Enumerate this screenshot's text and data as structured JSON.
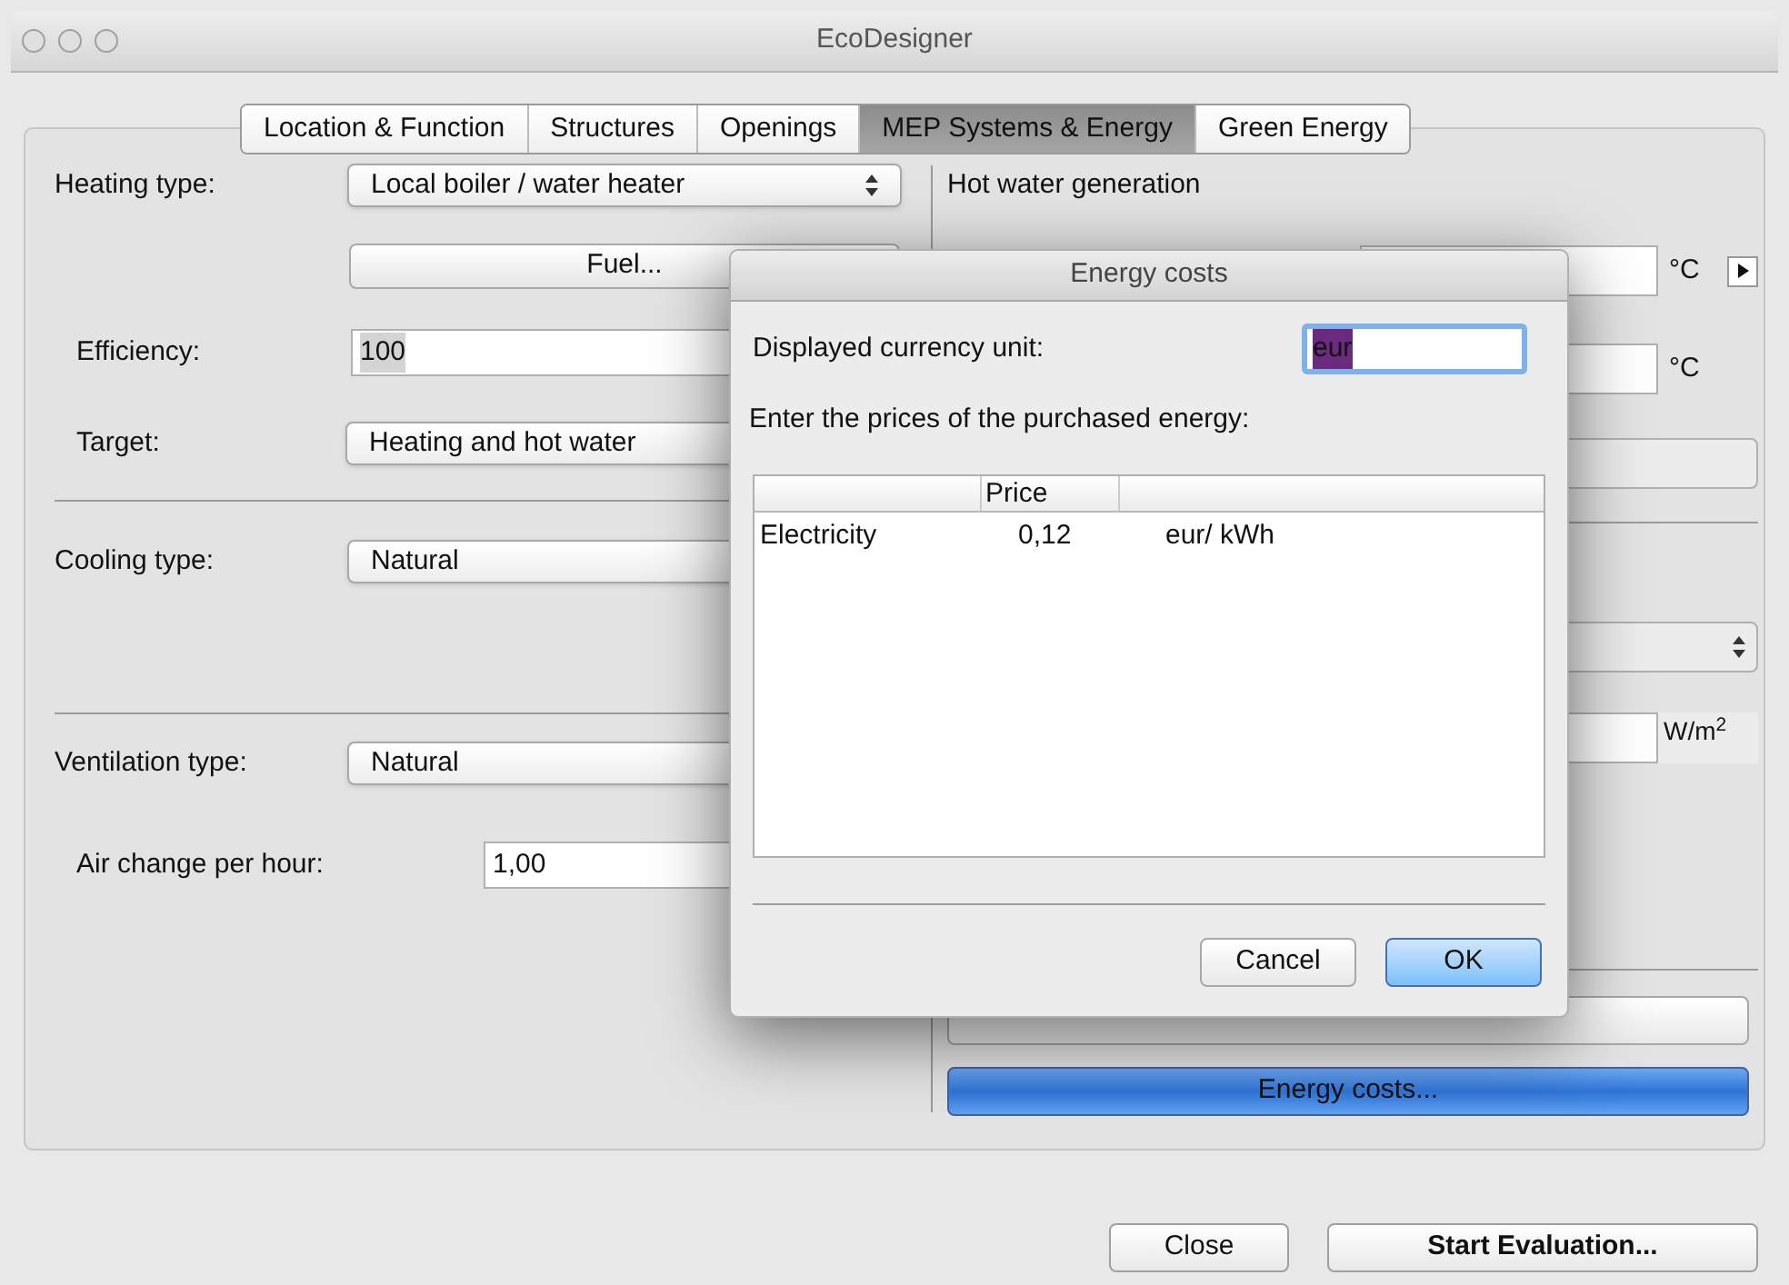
{
  "window": {
    "title": "EcoDesigner"
  },
  "tabs": [
    {
      "label": "Location & Function",
      "selected": false
    },
    {
      "label": "Structures",
      "selected": false
    },
    {
      "label": "Openings",
      "selected": false
    },
    {
      "label": "MEP Systems & Energy",
      "selected": true
    },
    {
      "label": "Green Energy",
      "selected": false
    }
  ],
  "heating": {
    "label": "Heating type:",
    "value": "Local boiler / water heater",
    "fuel_button": "Fuel...",
    "efficiency_label": "Efficiency:",
    "efficiency_value": "100",
    "target_label": "Target:",
    "target_value": "Heating and hot water"
  },
  "cooling": {
    "label": "Cooling type:",
    "value": "Natural"
  },
  "ventilation": {
    "label": "Ventilation type:",
    "value": "Natural",
    "air_change_label": "Air change per hour:",
    "air_change_value": "1,00"
  },
  "hot_water": {
    "title": "Hot water generation",
    "units": [
      "°C",
      "°C"
    ],
    "power_unit": "W/m$^{2}$"
  },
  "energy_buttons": [
    {
      "active": false
    },
    {
      "label": "Energy costs...",
      "active": true
    }
  ],
  "dialog": {
    "title": "Energy costs",
    "currency_label": "Displayed currency unit:",
    "currency_value": "eur",
    "prices_label": "Enter the prices of the purchased energy:",
    "table": {
      "columns": [
        "Price"
      ],
      "rows": [
        {
          "name": "Electricity",
          "price": "0,12",
          "unit": "eur/ kWh"
        }
      ]
    },
    "buttons": [
      {
        "label": "Cancel",
        "default": false
      },
      {
        "label": "OK",
        "default": true
      }
    ]
  },
  "footer_buttons": [
    {
      "label": "Close",
      "bold": false
    },
    {
      "label": "Start Evaluation...",
      "bold": true
    }
  ]
}
